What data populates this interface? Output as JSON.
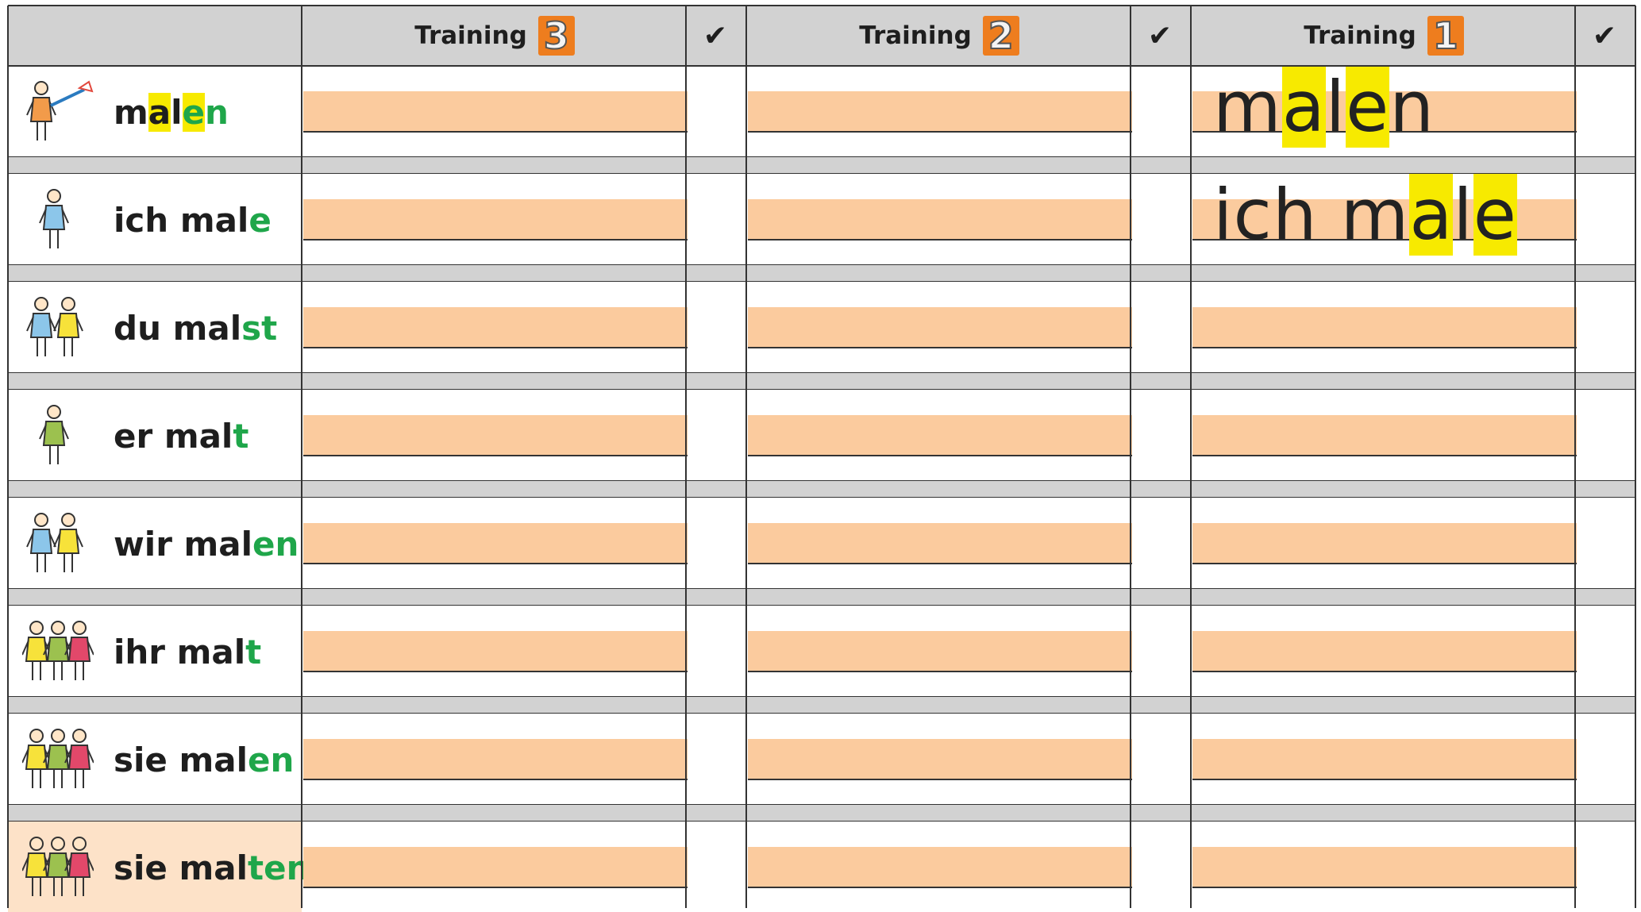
{
  "header": {
    "columns": [
      {
        "label": "Training",
        "number": "3"
      },
      {
        "label": "Training",
        "number": "2"
      },
      {
        "label": "Training",
        "number": "1"
      }
    ],
    "check_symbol": "✔"
  },
  "rows": [
    {
      "figure": "girl-painting-icon",
      "word_parts": [
        {
          "t": "m"
        },
        {
          "t": "a",
          "vy": true
        },
        {
          "t": "l"
        },
        {
          "t": "e",
          "vy": true,
          "end": true
        },
        {
          "t": "n",
          "end": true
        }
      ]
    },
    {
      "figure": "girl-icon",
      "word_parts": [
        {
          "t": "ich mal"
        },
        {
          "t": "e",
          "end": true
        }
      ]
    },
    {
      "figure": "two-kids-pointing-icon",
      "word_parts": [
        {
          "t": "du mal"
        },
        {
          "t": "st",
          "end": true
        }
      ]
    },
    {
      "figure": "boy-icon",
      "word_parts": [
        {
          "t": "er mal"
        },
        {
          "t": "t",
          "end": true
        }
      ]
    },
    {
      "figure": "two-kids-icon",
      "word_parts": [
        {
          "t": "wir mal"
        },
        {
          "t": "en",
          "end": true
        }
      ]
    },
    {
      "figure": "family-group-icon",
      "word_parts": [
        {
          "t": "ihr mal"
        },
        {
          "t": "t",
          "end": true
        }
      ]
    },
    {
      "figure": "family-icon",
      "word_parts": [
        {
          "t": "sie mal"
        },
        {
          "t": "en",
          "end": true
        }
      ]
    },
    {
      "figure": "family-icon",
      "highlighted": true,
      "word_parts": [
        {
          "t": "sie mal"
        },
        {
          "t": "ten",
          "end": true
        }
      ]
    }
  ],
  "examples": [
    {
      "row": 0,
      "parts": [
        {
          "t": "m"
        },
        {
          "t": "a",
          "vy": true
        },
        {
          "t": "l"
        },
        {
          "t": "e",
          "vy": true
        },
        {
          "t": "n"
        }
      ]
    },
    {
      "row": 1,
      "parts": [
        {
          "t": "ich m"
        },
        {
          "t": "a",
          "vy": true
        },
        {
          "t": "l"
        },
        {
          "t": "e",
          "vy": true
        }
      ]
    }
  ],
  "colors": {
    "writing_band": "#fbcb9e",
    "ending_green": "#1fa64a",
    "vowel_yellow": "#f7ea00",
    "badge_orange": "#ee7d1e",
    "header_grey": "#d2d2d2"
  }
}
